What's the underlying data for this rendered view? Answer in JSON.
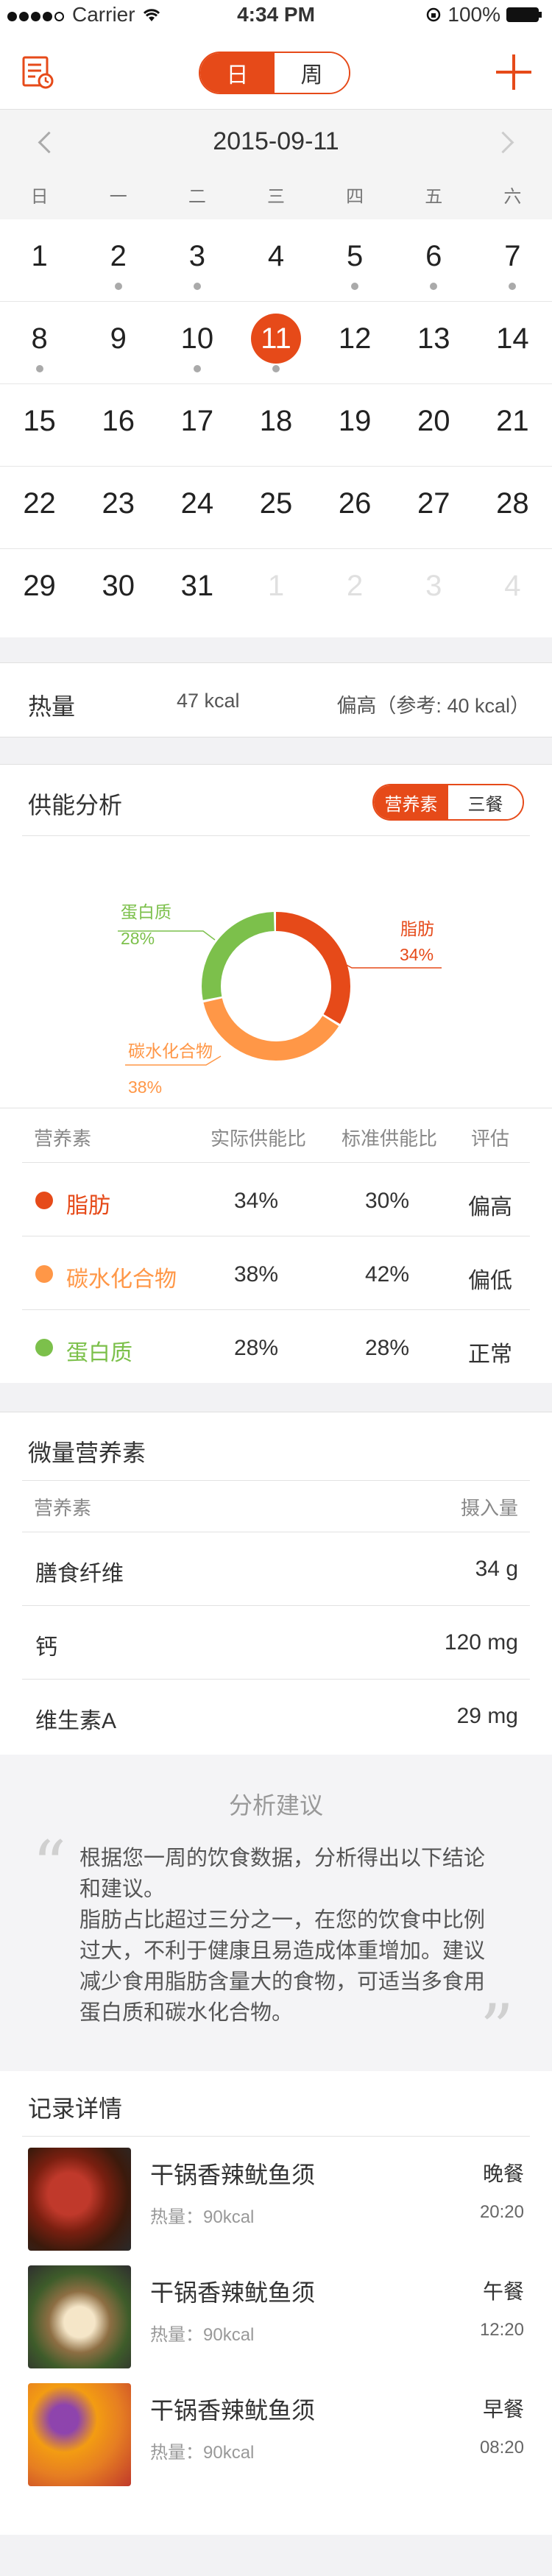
{
  "status_bar": {
    "carrier": "Carrier",
    "time": "4:34 PM",
    "battery": "100%"
  },
  "nav": {
    "tabs": [
      "日",
      "周"
    ],
    "active_tab": 0,
    "record_icon": "record-list-icon",
    "add_icon": "plus-icon"
  },
  "calendar": {
    "date": "2015-09-11",
    "weekdays": [
      "日",
      "一",
      "二",
      "三",
      "四",
      "五",
      "六"
    ],
    "weeks": [
      [
        "1",
        "2",
        "3",
        "4",
        "5",
        "6",
        "7"
      ],
      [
        "8",
        "9",
        "10",
        "11",
        "12",
        "13",
        "14"
      ],
      [
        "15",
        "16",
        "17",
        "18",
        "19",
        "20",
        "21"
      ],
      [
        "22",
        "23",
        "24",
        "25",
        "26",
        "27",
        "28"
      ],
      [
        "29",
        "30",
        "31",
        "1",
        "2",
        "3",
        "4"
      ]
    ]
  },
  "calorie": {
    "label": "热量",
    "value": "47 kcal",
    "reference": "偏高（参考: 40 kcal）"
  },
  "energy": {
    "title": "供能分析",
    "tabs": [
      "营养素",
      "三餐"
    ],
    "active_tab": 0,
    "chart_data": {
      "type": "pie",
      "donut": true,
      "categories": [
        "脂肪",
        "碳水化合物",
        "蛋白质"
      ],
      "values": [
        34,
        38,
        28
      ],
      "labels": [
        "34%",
        "38%",
        "28%"
      ],
      "colors": [
        "#e64a19",
        "#ff9747",
        "#7cc04b"
      ]
    },
    "table_headers": [
      "营养素",
      "实际供能比",
      "标准供能比",
      "评估"
    ],
    "rows": [
      {
        "name": "脂肪",
        "actual": "34%",
        "standard": "30%",
        "eval": "偏高",
        "color": "#e64a19"
      },
      {
        "name": "碳水化合物",
        "actual": "38%",
        "standard": "42%",
        "eval": "偏低",
        "color": "#ff9747"
      },
      {
        "name": "蛋白质",
        "actual": "28%",
        "standard": "28%",
        "eval": "正常",
        "color": "#7cc04b"
      }
    ]
  },
  "micro": {
    "title": "微量营养素",
    "headers": [
      "营养素",
      "摄入量"
    ],
    "rows": [
      {
        "name": "膳食纤维",
        "amount": "34 g"
      },
      {
        "name": "钙",
        "amount": "120 mg"
      },
      {
        "name": "维生素A",
        "amount": "29 mg"
      }
    ]
  },
  "advice": {
    "title": "分析建议",
    "lines": [
      "根据您一周的饮食数据，分析得出以下结论",
      "和建议。",
      "脂肪占比超过三分之一，在您的饮食中比例",
      "过大，不利于健康且易造成体重增加。建议",
      "减少食用脂肪含量大的食物，可适当多食用",
      "蛋白质和碳水化合物。"
    ]
  },
  "records": {
    "title": "记录详情",
    "items": [
      {
        "name": "干锅香辣鱿鱼须",
        "cal": "热量：90kcal",
        "meal": "晚餐",
        "time": "20:20"
      },
      {
        "name": "干锅香辣鱿鱼须",
        "cal": "热量：90kcal",
        "meal": "午餐",
        "time": "12:20"
      },
      {
        "name": "干锅香辣鱿鱼须",
        "cal": "热量：90kcal",
        "meal": "早餐",
        "time": "08:20"
      }
    ]
  }
}
